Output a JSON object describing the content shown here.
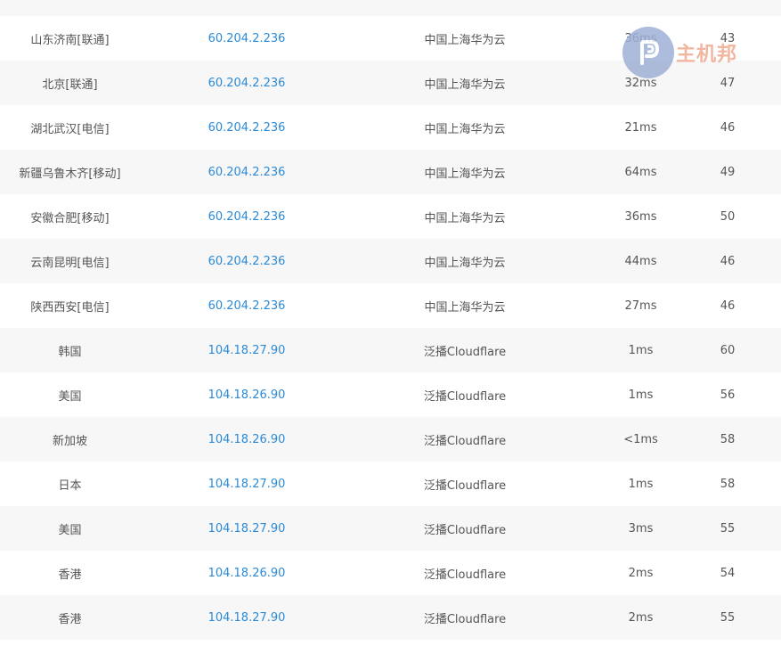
{
  "table": {
    "rows": [
      {
        "location": "",
        "ip": "",
        "isp": "",
        "time": "",
        "ttl": ""
      },
      {
        "location": "山东济南[联通]",
        "ip": "60.204.2.236",
        "isp": "中国上海华为云",
        "time": "36ms",
        "ttl": "43"
      },
      {
        "location": "北京[联通]",
        "ip": "60.204.2.236",
        "isp": "中国上海华为云",
        "time": "32ms",
        "ttl": "47"
      },
      {
        "location": "湖北武汉[电信]",
        "ip": "60.204.2.236",
        "isp": "中国上海华为云",
        "time": "21ms",
        "ttl": "46"
      },
      {
        "location": "新疆乌鲁木齐[移动]",
        "ip": "60.204.2.236",
        "isp": "中国上海华为云",
        "time": "64ms",
        "ttl": "49"
      },
      {
        "location": "安徽合肥[移动]",
        "ip": "60.204.2.236",
        "isp": "中国上海华为云",
        "time": "36ms",
        "ttl": "50"
      },
      {
        "location": "云南昆明[电信]",
        "ip": "60.204.2.236",
        "isp": "中国上海华为云",
        "time": "44ms",
        "ttl": "46"
      },
      {
        "location": "陕西西安[电信]",
        "ip": "60.204.2.236",
        "isp": "中国上海华为云",
        "time": "27ms",
        "ttl": "46"
      },
      {
        "location": "韩国",
        "ip": "104.18.27.90",
        "isp": "泛播Cloudflare",
        "time": "1ms",
        "ttl": "60"
      },
      {
        "location": "美国",
        "ip": "104.18.26.90",
        "isp": "泛播Cloudflare",
        "time": "1ms",
        "ttl": "56"
      },
      {
        "location": "新加坡",
        "ip": "104.18.26.90",
        "isp": "泛播Cloudflare",
        "time": "<1ms",
        "ttl": "58"
      },
      {
        "location": "日本",
        "ip": "104.18.27.90",
        "isp": "泛播Cloudflare",
        "time": "1ms",
        "ttl": "58"
      },
      {
        "location": "美国",
        "ip": "104.18.27.90",
        "isp": "泛播Cloudflare",
        "time": "3ms",
        "ttl": "55"
      },
      {
        "location": "香港",
        "ip": "104.18.26.90",
        "isp": "泛播Cloudflare",
        "time": "2ms",
        "ttl": "54"
      },
      {
        "location": "香港",
        "ip": "104.18.27.90",
        "isp": "泛播Cloudflare",
        "time": "2ms",
        "ttl": "55"
      }
    ]
  },
  "watermark": {
    "text": "主机邦",
    "icon": "p-logo-icon"
  }
}
